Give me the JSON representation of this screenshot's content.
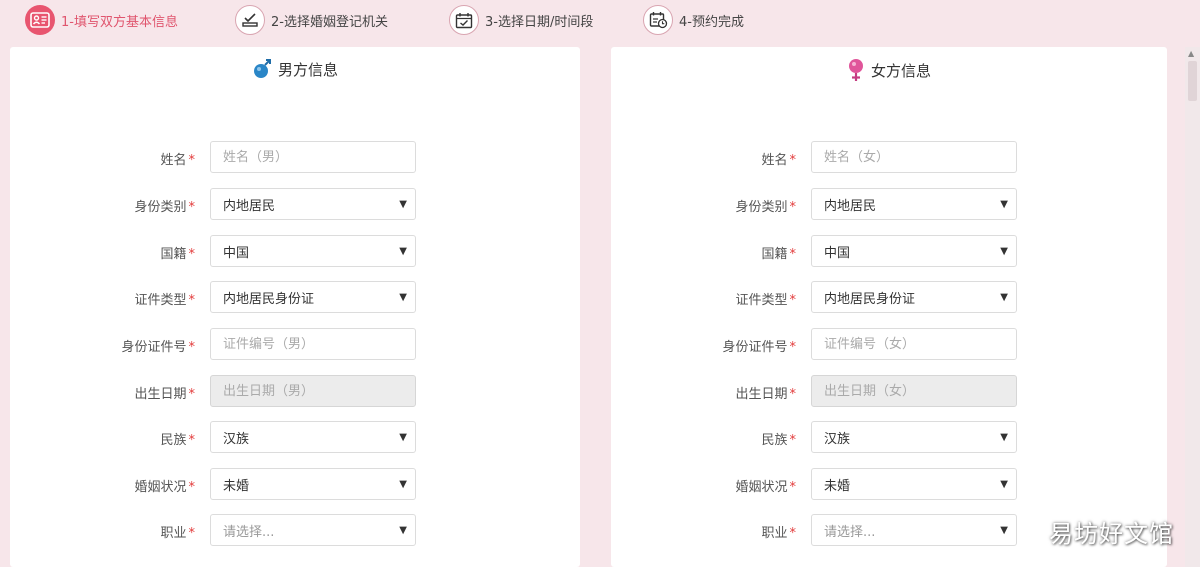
{
  "steps": [
    {
      "label": "1-填写双方基本信息",
      "icon": "id-card-icon",
      "active": true
    },
    {
      "label": "2-选择婚姻登记机关",
      "icon": "stamp-icon",
      "active": false
    },
    {
      "label": "3-选择日期/时间段",
      "icon": "calendar-check-icon",
      "active": false
    },
    {
      "label": "4-预约完成",
      "icon": "calendar-clock-icon",
      "active": false
    }
  ],
  "male": {
    "title": "男方信息",
    "icon": "male-icon",
    "fields": {
      "name": {
        "label": "姓名",
        "placeholder": "姓名（男）"
      },
      "id_category": {
        "label": "身份类别",
        "value": "内地居民"
      },
      "nationality": {
        "label": "国籍",
        "value": "中国"
      },
      "doc_type": {
        "label": "证件类型",
        "value": "内地居民身份证"
      },
      "id_number": {
        "label": "身份证件号",
        "placeholder": "证件编号（男）"
      },
      "birth_date": {
        "label": "出生日期",
        "placeholder": "出生日期（男）"
      },
      "ethnicity": {
        "label": "民族",
        "value": "汉族"
      },
      "marital": {
        "label": "婚姻状况",
        "value": "未婚"
      },
      "occupation": {
        "label": "职业",
        "value": "请选择..."
      }
    }
  },
  "female": {
    "title": "女方信息",
    "icon": "female-icon",
    "fields": {
      "name": {
        "label": "姓名",
        "placeholder": "姓名（女）"
      },
      "id_category": {
        "label": "身份类别",
        "value": "内地居民"
      },
      "nationality": {
        "label": "国籍",
        "value": "中国"
      },
      "doc_type": {
        "label": "证件类型",
        "value": "内地居民身份证"
      },
      "id_number": {
        "label": "身份证件号",
        "placeholder": "证件编号（女）"
      },
      "birth_date": {
        "label": "出生日期",
        "placeholder": "出生日期（女）"
      },
      "ethnicity": {
        "label": "民族",
        "value": "汉族"
      },
      "marital": {
        "label": "婚姻状况",
        "value": "未婚"
      },
      "occupation": {
        "label": "职业",
        "value": "请选择..."
      }
    }
  },
  "required_mark": "*",
  "watermark": "易坊好文馆",
  "colors": {
    "accent": "#e8556f",
    "background": "#f7e6ea",
    "required": "#e23a3a",
    "male": "#2a86c7",
    "female": "#e0559a"
  }
}
